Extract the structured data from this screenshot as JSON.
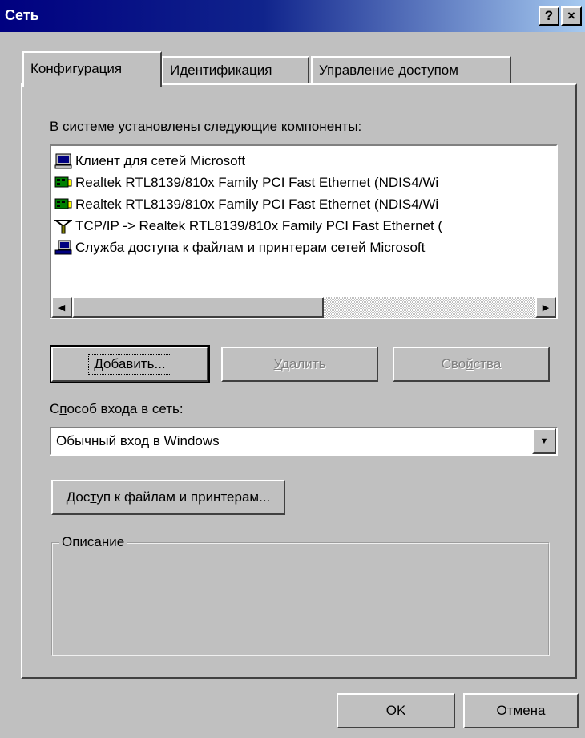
{
  "window": {
    "title": "Сеть",
    "help_button": "?",
    "close_button": "×"
  },
  "tabs": [
    {
      "label": "Конфигурация",
      "active": true
    },
    {
      "label": "Идентификация",
      "active": false
    },
    {
      "label": "Управление доступом",
      "active": false
    }
  ],
  "components": {
    "heading_before": "В системе установлены следующие ",
    "heading_hotkey": "к",
    "heading_after": "омпоненты:",
    "items": [
      {
        "icon": "client-icon",
        "label": "Клиент для сетей Microsoft"
      },
      {
        "icon": "adapter-icon",
        "label": "Realtek RTL8139/810x Family PCI Fast Ethernet (NDIS4/Wi"
      },
      {
        "icon": "adapter-icon",
        "label": "Realtek RTL8139/810x Family PCI Fast Ethernet (NDIS4/Wi"
      },
      {
        "icon": "protocol-icon",
        "label": "TCP/IP -> Realtek RTL8139/810x Family PCI Fast Ethernet ("
      },
      {
        "icon": "service-icon",
        "label": "Служба доступа к файлам и принтерам сетей Microsoft"
      }
    ]
  },
  "buttons": {
    "add": {
      "hotkey": "Д",
      "rest": "обавить..."
    },
    "remove": {
      "hotkey": "У",
      "rest": "далить"
    },
    "properties": {
      "before": "Сво",
      "hotkey": "й",
      "after": "ства"
    },
    "file_sharing": {
      "before": "Дос",
      "hotkey": "т",
      "after": "уп к файлам и принтерам..."
    },
    "ok": "OK",
    "cancel": "Отмена"
  },
  "logon": {
    "label_before": "С",
    "label_hotkey": "п",
    "label_after": "особ входа в сеть:",
    "selected": "Обычный вход в Windows"
  },
  "description": {
    "label": "Описание"
  },
  "colors": {
    "face": "#c0c0c0",
    "title_start": "#000080",
    "title_end": "#a6caf0"
  }
}
